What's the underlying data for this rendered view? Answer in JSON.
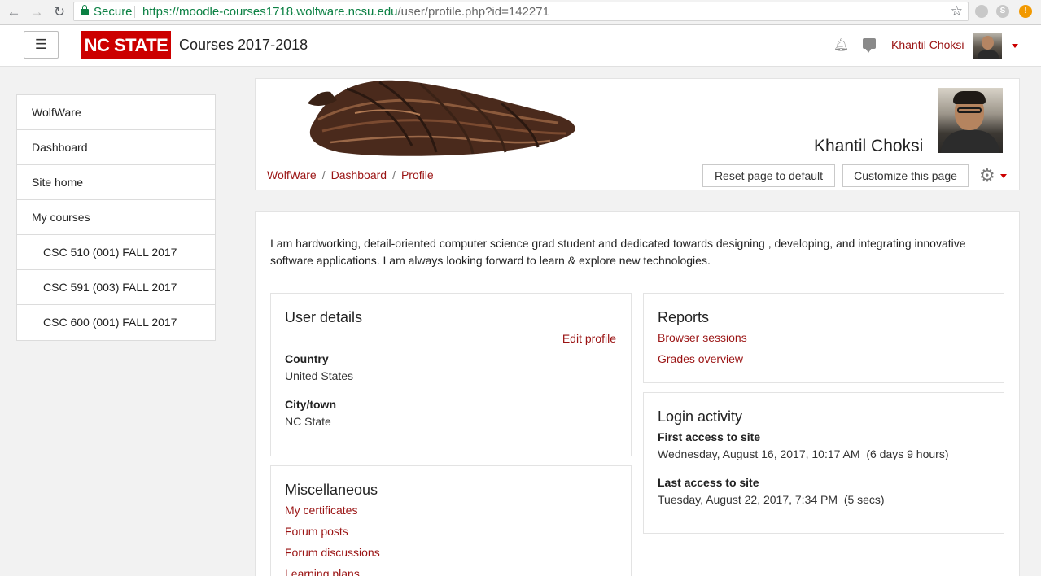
{
  "browser": {
    "secure_label": "Secure",
    "url_host": "https://moodle-courses1718.wolfware.ncsu.edu",
    "url_path": "/user/profile.php?id=142271"
  },
  "navbar": {
    "logo_text": "NC STATE",
    "site_name": "Courses 2017-2018",
    "user_name": "Khantil Choksi"
  },
  "drawer": {
    "items": [
      {
        "label": "WolfWare"
      },
      {
        "label": "Dashboard"
      },
      {
        "label": "Site home"
      },
      {
        "label": "My courses"
      },
      {
        "label": "CSC 510 (001) FALL 2017"
      },
      {
        "label": "CSC 591 (003) FALL 2017"
      },
      {
        "label": "CSC 600 (001) FALL 2017"
      }
    ]
  },
  "header": {
    "profile_name": "Khantil Choksi",
    "breadcrumb": [
      "WolfWare",
      "Dashboard",
      "Profile"
    ],
    "reset_button": "Reset page to default",
    "customize_button": "Customize this page"
  },
  "profile": {
    "description": "I am hardworking, detail-oriented computer science grad student and dedicated towards designing , developing, and integrating innovative software applications. I am always looking forward to learn & explore new technologies."
  },
  "user_details": {
    "title": "User details",
    "edit_link": "Edit profile",
    "country_label": "Country",
    "country_value": "United States",
    "city_label": "City/town",
    "city_value": "NC State"
  },
  "misc": {
    "title": "Miscellaneous",
    "links": [
      "My certificates",
      "Forum posts",
      "Forum discussions",
      "Learning plans"
    ]
  },
  "reports": {
    "title": "Reports",
    "links": [
      "Browser sessions",
      "Grades overview"
    ]
  },
  "login_activity": {
    "title": "Login activity",
    "first_label": "First access to site",
    "first_value": "Wednesday, August 16, 2017, 10:17 AM  (6 days 9 hours)",
    "last_label": "Last access to site",
    "last_value": "Tuesday, August 22, 2017, 7:34 PM  (5 secs)"
  },
  "colors": {
    "brand_red": "#cc0000",
    "link_red": "#9a1313"
  }
}
